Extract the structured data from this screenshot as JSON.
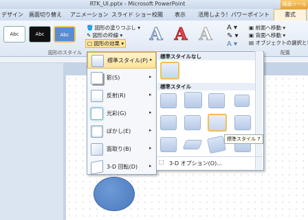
{
  "window": {
    "title": "RTK_UI.pptx - Microsoft PowerPoint",
    "context_tab": "描画ツール"
  },
  "tabs": [
    "デザイン",
    "画面切り替え",
    "アニメーション",
    "スライド ショー",
    "校閲",
    "表示",
    "活用しよう！パワーポイント",
    "書式"
  ],
  "ribbon": {
    "shape_styles": [
      "Abc",
      "Abc",
      "Abc"
    ],
    "shape_fill": "図形の塗りつぶし",
    "shape_outline": "図形の枠線",
    "shape_effects": "図形の効果",
    "group_shape_styles": "図形のスタイル",
    "wordart": [
      "A",
      "A",
      "A"
    ],
    "bring_forward": "前面へ移動",
    "send_backward": "背面へ移動",
    "selection_pane": "オブジェクトの選択と表示",
    "group_arrange": "配置"
  },
  "effects_menu": [
    {
      "label": "標準スタイル(P)"
    },
    {
      "label": "影(S)"
    },
    {
      "label": "反射(R)"
    },
    {
      "label": "光彩(G)"
    },
    {
      "label": "ぼかし(E)"
    },
    {
      "label": "面取り(B)"
    },
    {
      "label": "3-D 回転(D)"
    }
  ],
  "preset_gallery": {
    "header_none": "標準スタイルなし",
    "header_presets": "標準スタイル",
    "tooltip": "標準スタイル 7",
    "three_d_options": "3-D オプション(O)..."
  }
}
